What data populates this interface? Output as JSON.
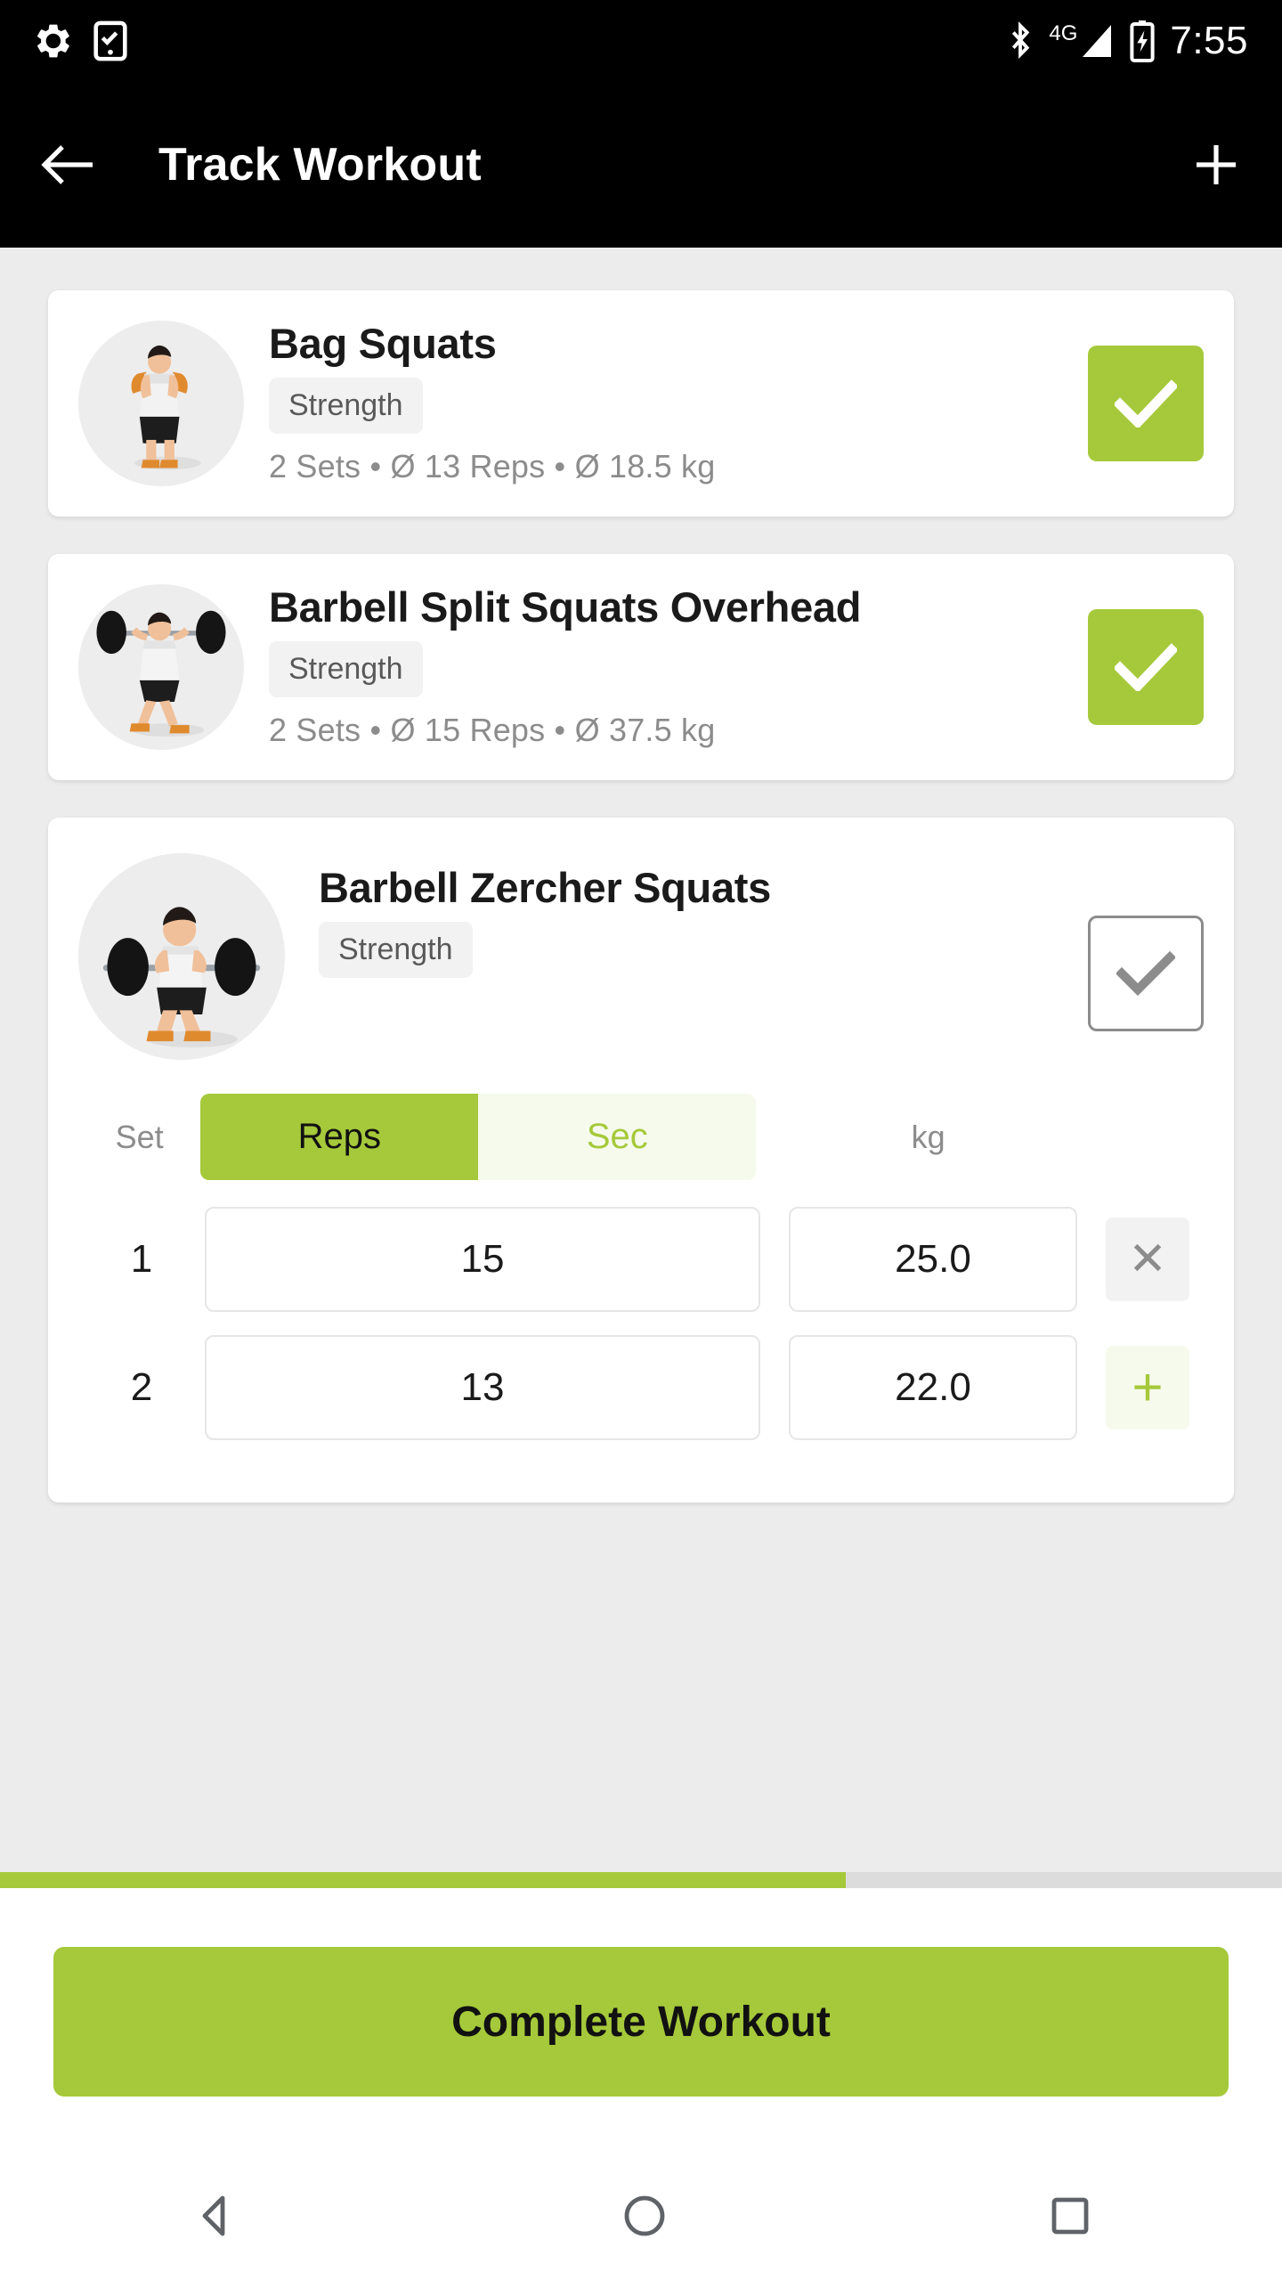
{
  "statusbar": {
    "time": "7:55",
    "left_icons": [
      "settings-gear-icon",
      "phone-checklist-icon"
    ],
    "right_icons": [
      "bluetooth-icon",
      "signal-4g-icon",
      "battery-charging-icon"
    ],
    "network_label": "4G"
  },
  "appbar": {
    "back_label": "←",
    "title": "Track Workout",
    "add_label": "+"
  },
  "exercises": [
    {
      "name": "Bag Squats",
      "category": "Strength",
      "meta": "2 Sets • Ø 13 Reps  • Ø 18.5 kg",
      "checked": true
    },
    {
      "name": "Barbell Split Squats Overhead",
      "category": "Strength",
      "meta": "2 Sets • Ø 15 Reps  • Ø 37.5 kg",
      "checked": true
    },
    {
      "name": "Barbell Zercher Squats",
      "category": "Strength",
      "checked": false,
      "expanded": true,
      "table": {
        "set_header": "Set",
        "unit_header": "kg",
        "toggle": {
          "reps_label": "Reps",
          "sec_label": "Sec",
          "selected": "Reps"
        },
        "rows": [
          {
            "set": "1",
            "reps": "15",
            "kg": "25.0",
            "action": "✕",
            "action_type": "delete"
          },
          {
            "set": "2",
            "reps": "13",
            "kg": "22.0",
            "action": "+",
            "action_type": "add"
          }
        ]
      }
    }
  ],
  "progress": {
    "percent": 66
  },
  "footer": {
    "cta_label": "Complete Workout"
  },
  "navbar": {
    "back": "nav-back-icon",
    "home": "nav-home-icon",
    "recents": "nav-recents-icon"
  },
  "colors": {
    "accent": "#A5C93A",
    "accent_pale": "#F6FAEC",
    "appbar_bg": "#000000",
    "page_bg": "#ECECEC",
    "card_bg": "#FFFFFF",
    "muted_text": "#8C8C8C"
  }
}
